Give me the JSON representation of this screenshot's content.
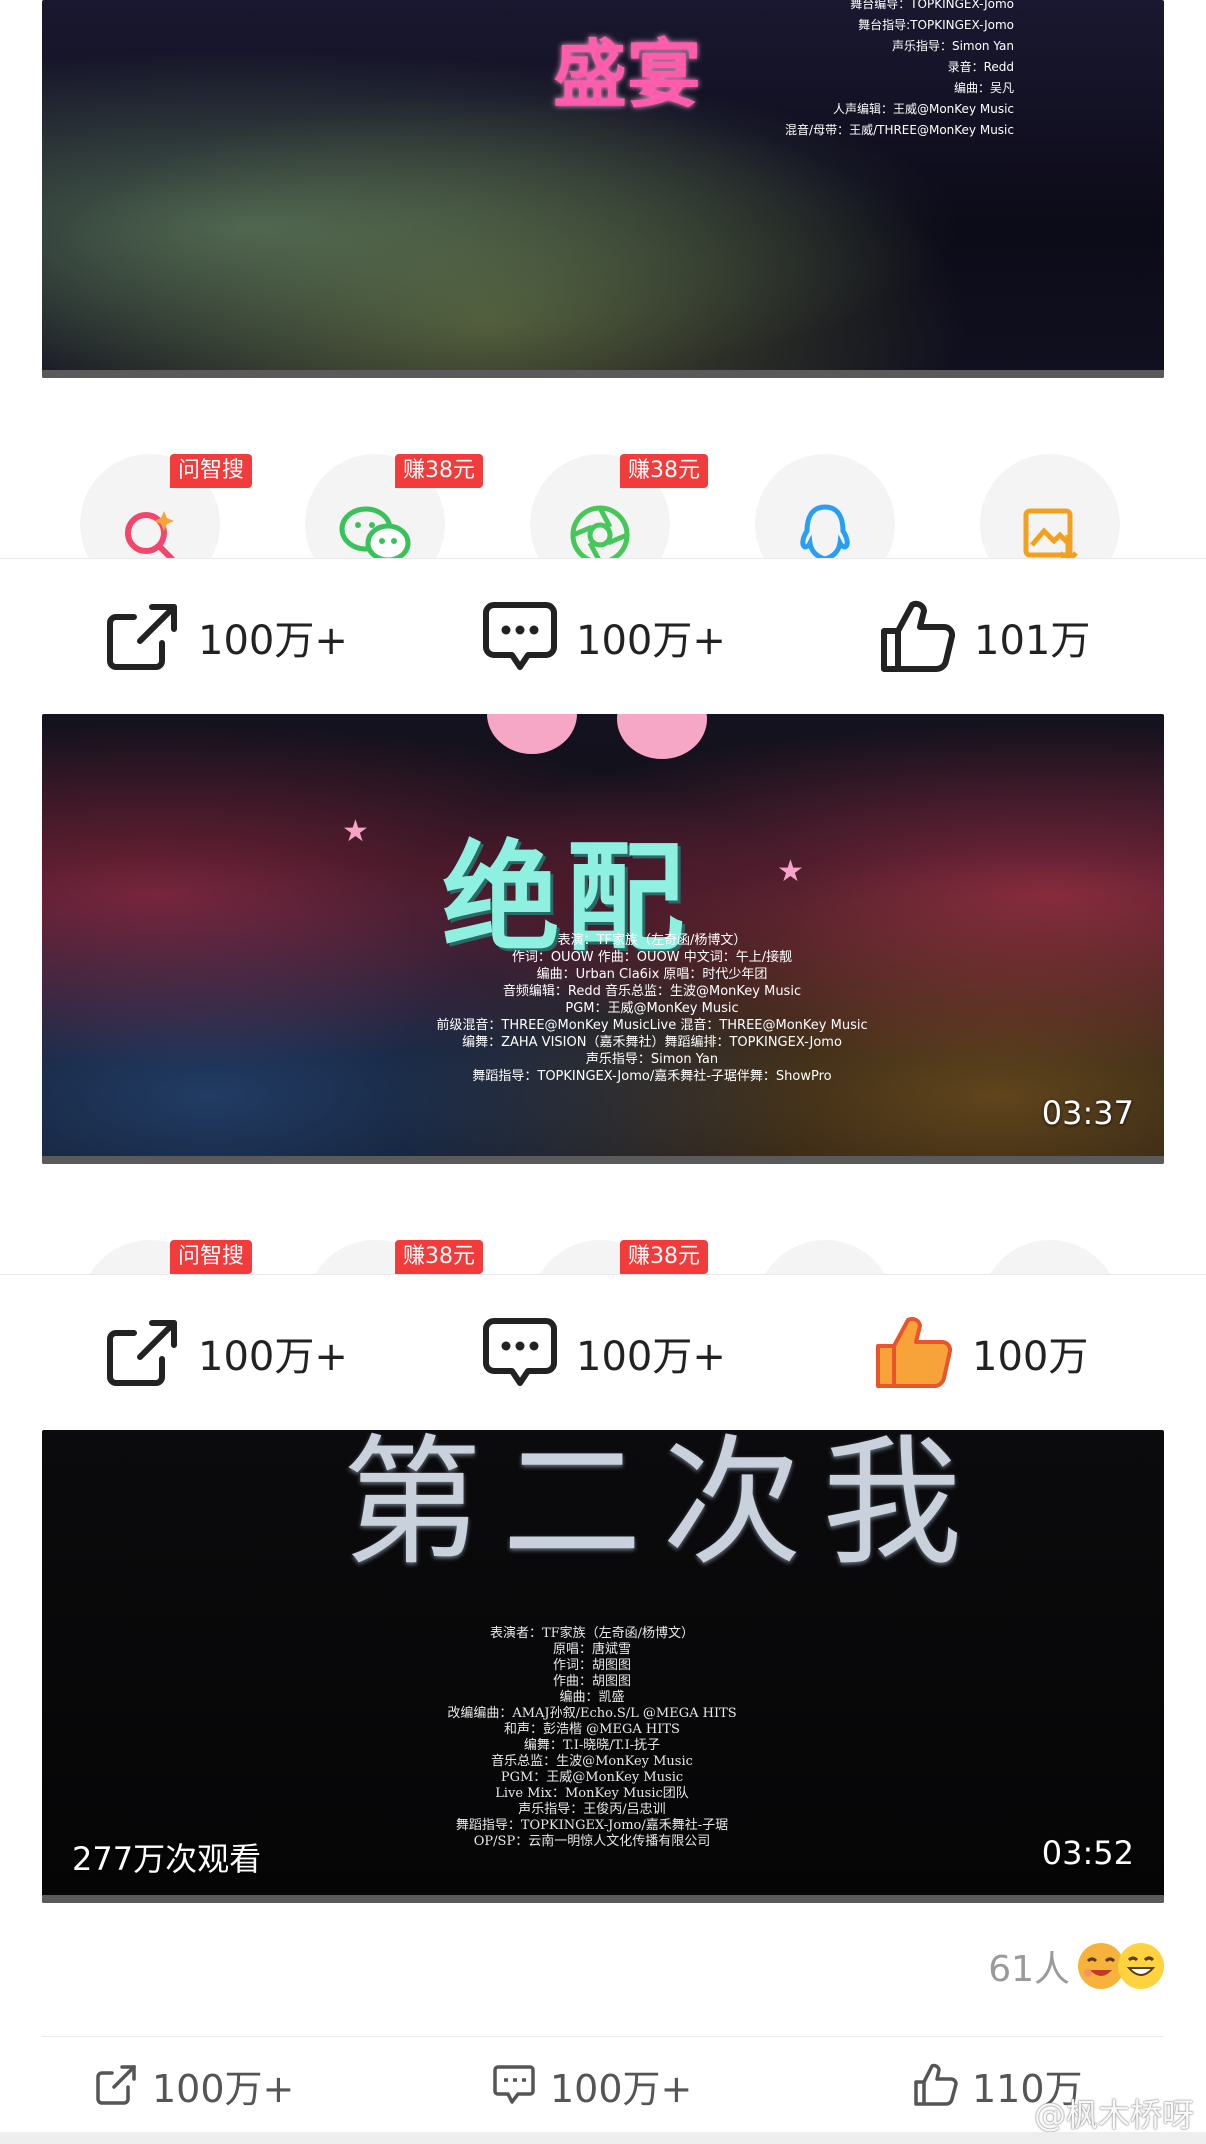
{
  "videos": [
    {
      "title_art": "盛宴",
      "credits": [
        "舞台编导：TOPKINGEX-Jomo",
        "舞台指导:TOPKINGEX-Jomo",
        "声乐指导：Simon Yan",
        "录音：Redd",
        "编曲：吴凡",
        "人声编辑：王威@MonKey Music",
        "混音/母带：王威/THREE@MonKey Music"
      ]
    },
    {
      "title_art": "绝配",
      "credits": [
        "表演：TF家族（左奇函/杨博文）",
        "作词：OUOW 作曲：OUOW 中文词：午上/接靓",
        "编曲：Urban Cla6ix 原唱：时代少年团",
        "音频编辑：Redd 音乐总监：生波@MonKey Music",
        "PGM：王威@MonKey Music",
        "前级混音：THREE@MonKey MusicLive 混音：THREE@MonKey Music",
        "编舞：ZAHA VISION（嘉禾舞社）舞蹈编排：TOPKINGEX-Jomo",
        "声乐指导：Simon Yan",
        "舞蹈指导：TOPKINGEX-Jomo/嘉禾舞社-子琚伴舞：ShowPro"
      ],
      "duration": "03:37"
    },
    {
      "title_art": "第二次我",
      "credits": [
        "表演者：TF家族（左奇函/杨博文）",
        "原唱：唐斌雪",
        "作词：胡图图",
        "作曲：胡图图",
        "编曲：凯盛",
        "改编编曲：AMAJ孙叙/Echo.S/L @MEGA HITS",
        "和声：彭浩楷 @MEGA HITS",
        "编舞：T.I-晓晓/T.I-抚子",
        "音乐总监：生波@MonKey Music",
        "PGM：王威@MonKey Music",
        "Live Mix：MonKey Music团队",
        "声乐指导：王俊丙/吕忠训",
        "舞蹈指导：TOPKINGEX-Jomo/嘉禾舞社-子琚",
        "OP/SP：云南一明惊人文化传播有限公司"
      ],
      "views": "277万次观看",
      "duration": "03:52"
    }
  ],
  "share_panel": {
    "items": [
      {
        "icon": "ai-search-icon",
        "badge": "问智搜",
        "color": "#f2476b"
      },
      {
        "icon": "wechat-icon",
        "badge": "赚38元",
        "color": "#39c25a"
      },
      {
        "icon": "moments-icon",
        "badge": "赚38元",
        "color": "#46c75a"
      },
      {
        "icon": "qq-icon",
        "badge": "",
        "color": "#2a9ef2"
      },
      {
        "icon": "save-image-icon",
        "badge": "",
        "color": "#f2a020"
      }
    ]
  },
  "action_bars": [
    {
      "share": "100万+",
      "comment": "100万+",
      "like": "101万",
      "like_active": false
    },
    {
      "share": "100万+",
      "comment": "100万+",
      "like": "100万",
      "like_active": true
    }
  ],
  "footer": {
    "reaction_count": "61人",
    "share": "100万+",
    "comment": "100万+",
    "like": "110万",
    "watermark": "@枫木桥呀"
  }
}
